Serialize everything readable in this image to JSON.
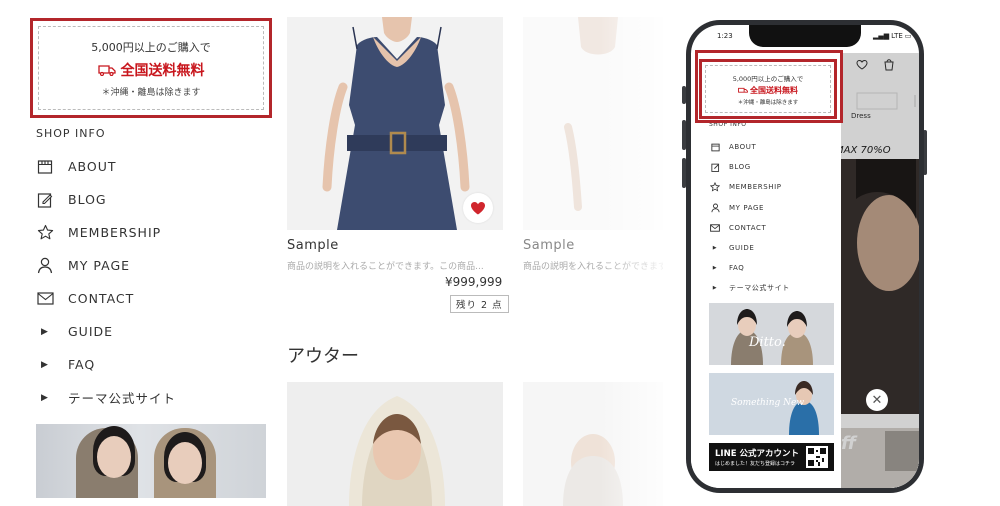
{
  "banner": {
    "line1": "5,000円以上のご購入で",
    "line2": "全国送料無料",
    "line3": "＊沖縄・離島は除きます"
  },
  "sidebar": {
    "title": "SHOP INFO",
    "items": [
      {
        "label": "ABOUT",
        "icon": "shop-icon"
      },
      {
        "label": "BLOG",
        "icon": "edit-icon"
      },
      {
        "label": "MEMBERSHIP",
        "icon": "star-icon"
      },
      {
        "label": "MY PAGE",
        "icon": "user-icon"
      },
      {
        "label": "CONTACT",
        "icon": "mail-icon"
      },
      {
        "label": "GUIDE",
        "icon": "caret-right-icon"
      },
      {
        "label": "FAQ",
        "icon": "caret-right-icon"
      },
      {
        "label": "テーマ公式サイト",
        "icon": "caret-right-icon"
      }
    ]
  },
  "products": [
    {
      "name": "Sample",
      "desc": "商品の説明を入れることができます。この商品...",
      "price": "¥999,999",
      "stock": "残り 2 点"
    },
    {
      "name": "Sample",
      "desc": "商品の説明を入れることができます。"
    }
  ],
  "section": {
    "title": "アウター"
  },
  "phone": {
    "time": "1:23",
    "network": "LTE",
    "tab": "Dress",
    "sale_text": "MAX 70%O",
    "banner_text": "LINE 公式アカウント",
    "banner_sub": "はじめました！友だち登録はコチラ",
    "logo1": "Ditto.",
    "logo2": "Something New",
    "side_text": "ff"
  },
  "colors": {
    "accent": "#b3262b",
    "sale_red": "#c8161d",
    "heart": "#d0262d"
  }
}
